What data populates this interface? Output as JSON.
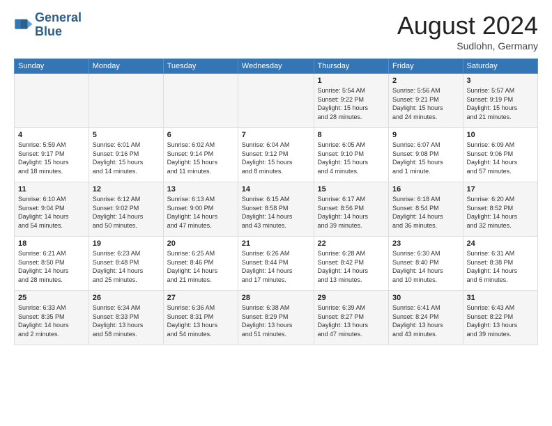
{
  "header": {
    "logo_line1": "General",
    "logo_line2": "Blue",
    "month_title": "August 2024",
    "location": "Sudlohn, Germany"
  },
  "weekdays": [
    "Sunday",
    "Monday",
    "Tuesday",
    "Wednesday",
    "Thursday",
    "Friday",
    "Saturday"
  ],
  "weeks": [
    [
      {
        "day": "",
        "info": ""
      },
      {
        "day": "",
        "info": ""
      },
      {
        "day": "",
        "info": ""
      },
      {
        "day": "",
        "info": ""
      },
      {
        "day": "1",
        "info": "Sunrise: 5:54 AM\nSunset: 9:22 PM\nDaylight: 15 hours\nand 28 minutes."
      },
      {
        "day": "2",
        "info": "Sunrise: 5:56 AM\nSunset: 9:21 PM\nDaylight: 15 hours\nand 24 minutes."
      },
      {
        "day": "3",
        "info": "Sunrise: 5:57 AM\nSunset: 9:19 PM\nDaylight: 15 hours\nand 21 minutes."
      }
    ],
    [
      {
        "day": "4",
        "info": "Sunrise: 5:59 AM\nSunset: 9:17 PM\nDaylight: 15 hours\nand 18 minutes."
      },
      {
        "day": "5",
        "info": "Sunrise: 6:01 AM\nSunset: 9:16 PM\nDaylight: 15 hours\nand 14 minutes."
      },
      {
        "day": "6",
        "info": "Sunrise: 6:02 AM\nSunset: 9:14 PM\nDaylight: 15 hours\nand 11 minutes."
      },
      {
        "day": "7",
        "info": "Sunrise: 6:04 AM\nSunset: 9:12 PM\nDaylight: 15 hours\nand 8 minutes."
      },
      {
        "day": "8",
        "info": "Sunrise: 6:05 AM\nSunset: 9:10 PM\nDaylight: 15 hours\nand 4 minutes."
      },
      {
        "day": "9",
        "info": "Sunrise: 6:07 AM\nSunset: 9:08 PM\nDaylight: 15 hours\nand 1 minute."
      },
      {
        "day": "10",
        "info": "Sunrise: 6:09 AM\nSunset: 9:06 PM\nDaylight: 14 hours\nand 57 minutes."
      }
    ],
    [
      {
        "day": "11",
        "info": "Sunrise: 6:10 AM\nSunset: 9:04 PM\nDaylight: 14 hours\nand 54 minutes."
      },
      {
        "day": "12",
        "info": "Sunrise: 6:12 AM\nSunset: 9:02 PM\nDaylight: 14 hours\nand 50 minutes."
      },
      {
        "day": "13",
        "info": "Sunrise: 6:13 AM\nSunset: 9:00 PM\nDaylight: 14 hours\nand 47 minutes."
      },
      {
        "day": "14",
        "info": "Sunrise: 6:15 AM\nSunset: 8:58 PM\nDaylight: 14 hours\nand 43 minutes."
      },
      {
        "day": "15",
        "info": "Sunrise: 6:17 AM\nSunset: 8:56 PM\nDaylight: 14 hours\nand 39 minutes."
      },
      {
        "day": "16",
        "info": "Sunrise: 6:18 AM\nSunset: 8:54 PM\nDaylight: 14 hours\nand 36 minutes."
      },
      {
        "day": "17",
        "info": "Sunrise: 6:20 AM\nSunset: 8:52 PM\nDaylight: 14 hours\nand 32 minutes."
      }
    ],
    [
      {
        "day": "18",
        "info": "Sunrise: 6:21 AM\nSunset: 8:50 PM\nDaylight: 14 hours\nand 28 minutes."
      },
      {
        "day": "19",
        "info": "Sunrise: 6:23 AM\nSunset: 8:48 PM\nDaylight: 14 hours\nand 25 minutes."
      },
      {
        "day": "20",
        "info": "Sunrise: 6:25 AM\nSunset: 8:46 PM\nDaylight: 14 hours\nand 21 minutes."
      },
      {
        "day": "21",
        "info": "Sunrise: 6:26 AM\nSunset: 8:44 PM\nDaylight: 14 hours\nand 17 minutes."
      },
      {
        "day": "22",
        "info": "Sunrise: 6:28 AM\nSunset: 8:42 PM\nDaylight: 14 hours\nand 13 minutes."
      },
      {
        "day": "23",
        "info": "Sunrise: 6:30 AM\nSunset: 8:40 PM\nDaylight: 14 hours\nand 10 minutes."
      },
      {
        "day": "24",
        "info": "Sunrise: 6:31 AM\nSunset: 8:38 PM\nDaylight: 14 hours\nand 6 minutes."
      }
    ],
    [
      {
        "day": "25",
        "info": "Sunrise: 6:33 AM\nSunset: 8:35 PM\nDaylight: 14 hours\nand 2 minutes."
      },
      {
        "day": "26",
        "info": "Sunrise: 6:34 AM\nSunset: 8:33 PM\nDaylight: 13 hours\nand 58 minutes."
      },
      {
        "day": "27",
        "info": "Sunrise: 6:36 AM\nSunset: 8:31 PM\nDaylight: 13 hours\nand 54 minutes."
      },
      {
        "day": "28",
        "info": "Sunrise: 6:38 AM\nSunset: 8:29 PM\nDaylight: 13 hours\nand 51 minutes."
      },
      {
        "day": "29",
        "info": "Sunrise: 6:39 AM\nSunset: 8:27 PM\nDaylight: 13 hours\nand 47 minutes."
      },
      {
        "day": "30",
        "info": "Sunrise: 6:41 AM\nSunset: 8:24 PM\nDaylight: 13 hours\nand 43 minutes."
      },
      {
        "day": "31",
        "info": "Sunrise: 6:43 AM\nSunset: 8:22 PM\nDaylight: 13 hours\nand 39 minutes."
      }
    ]
  ]
}
